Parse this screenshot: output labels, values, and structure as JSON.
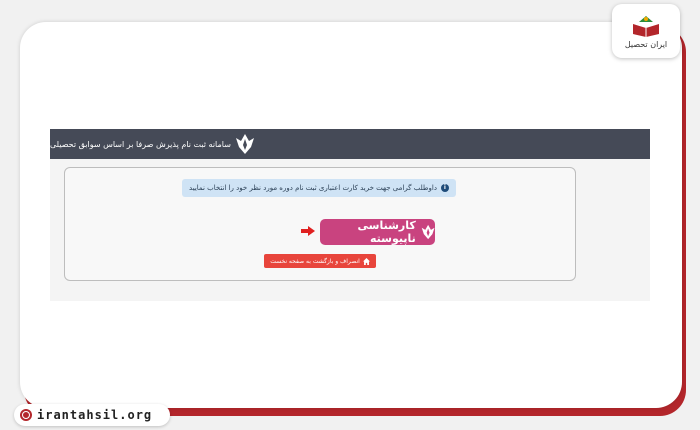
{
  "logo_badge": {
    "caption": "ایران تحصیل",
    "icon": "book-logo-icon"
  },
  "site_link": {
    "text": "irantahsil.org",
    "icon": "globe-icon"
  },
  "header": {
    "title": "سامانه ثبت نام پذیرش صرفا بر اساس سوابق تحصیلی",
    "icon": "university-logo-icon"
  },
  "alert": {
    "text": "داوطلب گرامی جهت خرید کارت اعتباری ثبت نام دوره مورد نظر خود را انتخاب نمایید",
    "icon": "info-icon"
  },
  "degree_button": {
    "label": "کارشناسی ناپیوسته",
    "icon": "university-logo-icon"
  },
  "back_button": {
    "label": "انصراف و بازگشت به صفحه نخست",
    "icon": "home-icon"
  },
  "colors": {
    "accent_red": "#b3262b",
    "header_bg": "#454a57",
    "degree_button": "#c9437f",
    "back_button": "#e8453c",
    "alert_bg": "#cfe3f5"
  }
}
